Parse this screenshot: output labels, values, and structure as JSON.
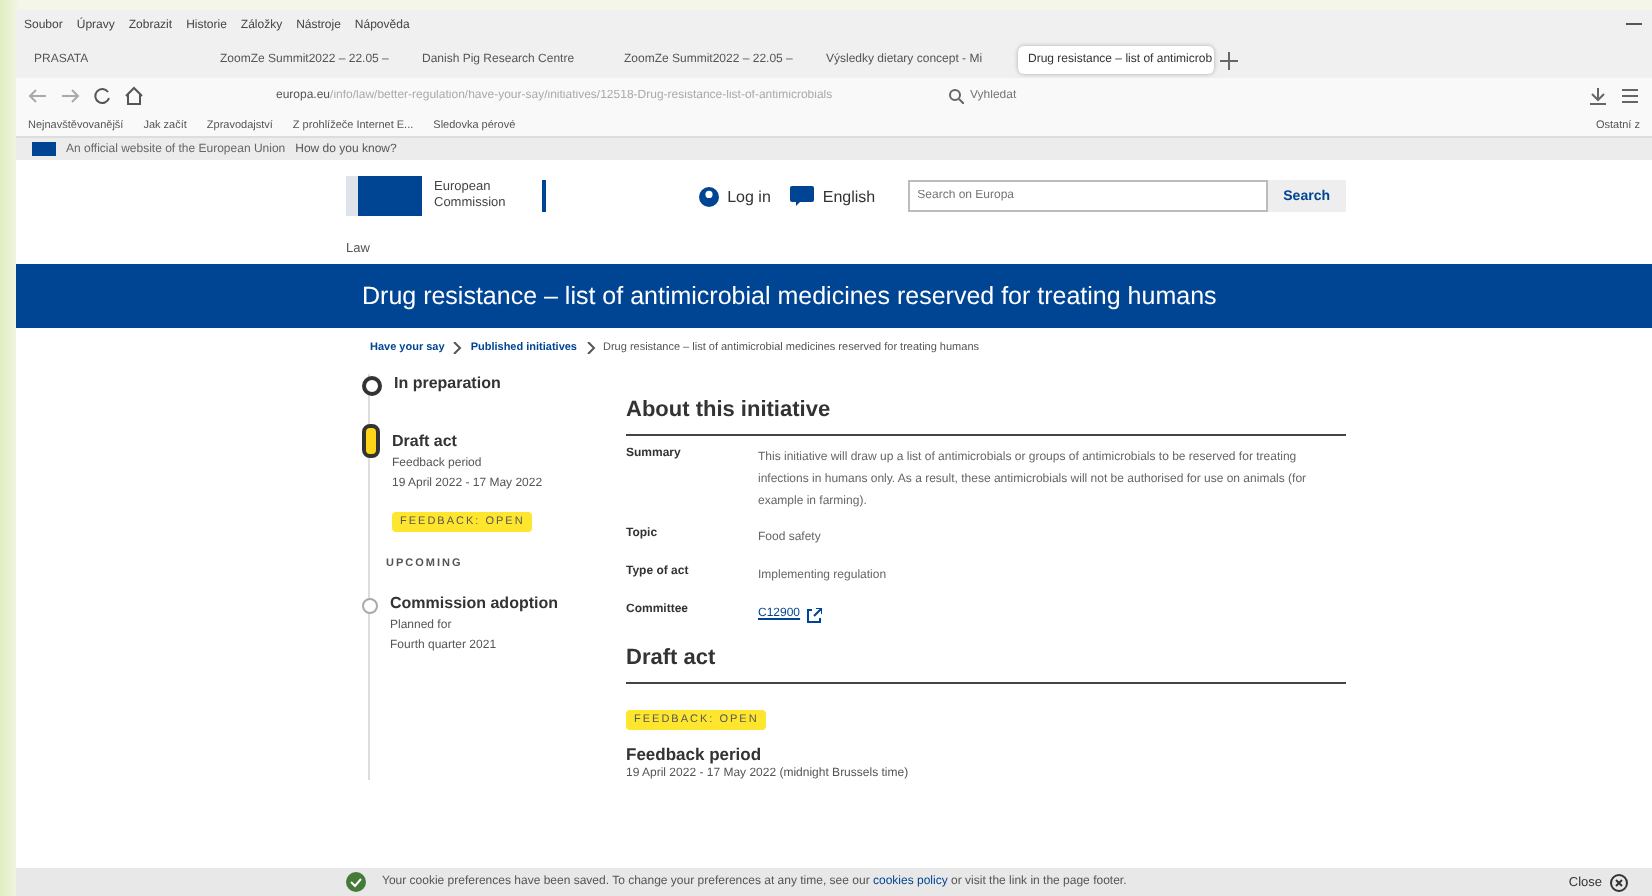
{
  "menu": [
    "Soubor",
    "Úpravy",
    "Zobrazit",
    "Historie",
    "Záložky",
    "Nástroje",
    "Nápověda"
  ],
  "tabs": [
    {
      "label": "PRASATA",
      "selected": false
    },
    {
      "label": "ZoomZe Summit2022 – 22.05 –",
      "selected": false
    },
    {
      "label": "Danish Pig Research Centre",
      "selected": false
    },
    {
      "label": "ZoomZe Summit2022 – 22.05 –",
      "selected": false
    },
    {
      "label": "Výsledky dietary concept - Mi",
      "selected": false
    },
    {
      "label": "Drug resistance – list of antimicrob",
      "selected": true
    }
  ],
  "address": {
    "domain": "europa.eu",
    "url_rest": "/info/law/better-regulation/have-your-say/initiatives/12518-Drug-resistance-list-of-antimicrobials",
    "search_placeholder": "Vyhledat"
  },
  "bookmarks": [
    "Nejnavštěvovanější",
    "Jak začít",
    "Zpravodajství",
    "Z prohlížeče Internet E...",
    "Sledovka pérové"
  ],
  "other_bookmarks": "Ostatní z",
  "eu_banner": {
    "text": "An official website of the European Union",
    "link": "How do you know?"
  },
  "header": {
    "logo": "European Commission",
    "login": "Log in",
    "language": "English",
    "search_placeholder": "Search on Europa",
    "search_button": "Search"
  },
  "section": "Law",
  "page_title": "Drug resistance – list of antimicrobial medicines reserved for treating humans",
  "breadcrumb": [
    "Have your say",
    "Published initiatives",
    "Drug resistance – list of antimicrobial medicines reserved for treating humans"
  ],
  "timeline": [
    {
      "kind": "done",
      "title": "In preparation"
    },
    {
      "kind": "current",
      "title": "Draft act",
      "lines": [
        "Feedback period",
        "19 April 2022 - 17 May 2022"
      ],
      "badge": "FEEDBACK: OPEN"
    },
    {
      "kind": "label",
      "title": "UPCOMING"
    },
    {
      "kind": "upcoming",
      "title": "Commission adoption",
      "lines": [
        "Planned for",
        "Fourth quarter 2021"
      ]
    }
  ],
  "about": {
    "heading": "About this initiative",
    "rows": [
      {
        "label": "Summary",
        "value": "This initiative will draw up a list of antimicrobials or groups of antimicrobials to be reserved for treating infections in humans only. As a result, these antimicrobials will not be authorised for use on animals (for example in farming).",
        "kind": "text"
      },
      {
        "label": "Topic",
        "value": "Food safety",
        "kind": "text"
      },
      {
        "label": "Type of act",
        "value": "Implementing regulation",
        "kind": "text"
      },
      {
        "label": "Committee",
        "value": "C12900",
        "kind": "link"
      }
    ]
  },
  "draft": {
    "heading": "Draft act",
    "badge": "FEEDBACK: OPEN",
    "period_title": "Feedback period",
    "period": "19 April 2022 - 17 May 2022  (midnight Brussels time)"
  },
  "cookie": {
    "before": "Your cookie preferences have been saved. To change your preferences at any time, see our",
    "link": "cookies policy",
    "after": "or visit the link in the page footer.",
    "close": "Close"
  }
}
